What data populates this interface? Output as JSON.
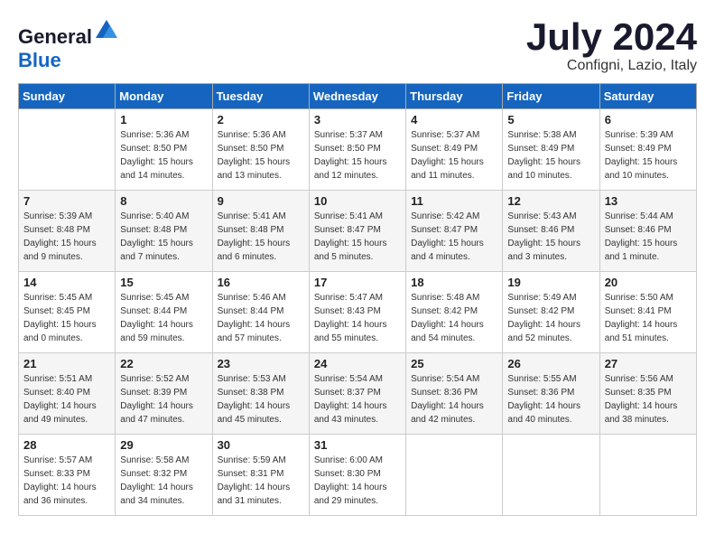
{
  "header": {
    "logo_general": "General",
    "logo_blue": "Blue",
    "month_year": "July 2024",
    "location": "Configni, Lazio, Italy"
  },
  "days_of_week": [
    "Sunday",
    "Monday",
    "Tuesday",
    "Wednesday",
    "Thursday",
    "Friday",
    "Saturday"
  ],
  "weeks": [
    [
      {
        "day": "",
        "info": ""
      },
      {
        "day": "1",
        "info": "Sunrise: 5:36 AM\nSunset: 8:50 PM\nDaylight: 15 hours\nand 14 minutes."
      },
      {
        "day": "2",
        "info": "Sunrise: 5:36 AM\nSunset: 8:50 PM\nDaylight: 15 hours\nand 13 minutes."
      },
      {
        "day": "3",
        "info": "Sunrise: 5:37 AM\nSunset: 8:50 PM\nDaylight: 15 hours\nand 12 minutes."
      },
      {
        "day": "4",
        "info": "Sunrise: 5:37 AM\nSunset: 8:49 PM\nDaylight: 15 hours\nand 11 minutes."
      },
      {
        "day": "5",
        "info": "Sunrise: 5:38 AM\nSunset: 8:49 PM\nDaylight: 15 hours\nand 10 minutes."
      },
      {
        "day": "6",
        "info": "Sunrise: 5:39 AM\nSunset: 8:49 PM\nDaylight: 15 hours\nand 10 minutes."
      }
    ],
    [
      {
        "day": "7",
        "info": "Sunrise: 5:39 AM\nSunset: 8:48 PM\nDaylight: 15 hours\nand 9 minutes."
      },
      {
        "day": "8",
        "info": "Sunrise: 5:40 AM\nSunset: 8:48 PM\nDaylight: 15 hours\nand 7 minutes."
      },
      {
        "day": "9",
        "info": "Sunrise: 5:41 AM\nSunset: 8:48 PM\nDaylight: 15 hours\nand 6 minutes."
      },
      {
        "day": "10",
        "info": "Sunrise: 5:41 AM\nSunset: 8:47 PM\nDaylight: 15 hours\nand 5 minutes."
      },
      {
        "day": "11",
        "info": "Sunrise: 5:42 AM\nSunset: 8:47 PM\nDaylight: 15 hours\nand 4 minutes."
      },
      {
        "day": "12",
        "info": "Sunrise: 5:43 AM\nSunset: 8:46 PM\nDaylight: 15 hours\nand 3 minutes."
      },
      {
        "day": "13",
        "info": "Sunrise: 5:44 AM\nSunset: 8:46 PM\nDaylight: 15 hours\nand 1 minute."
      }
    ],
    [
      {
        "day": "14",
        "info": "Sunrise: 5:45 AM\nSunset: 8:45 PM\nDaylight: 15 hours\nand 0 minutes."
      },
      {
        "day": "15",
        "info": "Sunrise: 5:45 AM\nSunset: 8:44 PM\nDaylight: 14 hours\nand 59 minutes."
      },
      {
        "day": "16",
        "info": "Sunrise: 5:46 AM\nSunset: 8:44 PM\nDaylight: 14 hours\nand 57 minutes."
      },
      {
        "day": "17",
        "info": "Sunrise: 5:47 AM\nSunset: 8:43 PM\nDaylight: 14 hours\nand 55 minutes."
      },
      {
        "day": "18",
        "info": "Sunrise: 5:48 AM\nSunset: 8:42 PM\nDaylight: 14 hours\nand 54 minutes."
      },
      {
        "day": "19",
        "info": "Sunrise: 5:49 AM\nSunset: 8:42 PM\nDaylight: 14 hours\nand 52 minutes."
      },
      {
        "day": "20",
        "info": "Sunrise: 5:50 AM\nSunset: 8:41 PM\nDaylight: 14 hours\nand 51 minutes."
      }
    ],
    [
      {
        "day": "21",
        "info": "Sunrise: 5:51 AM\nSunset: 8:40 PM\nDaylight: 14 hours\nand 49 minutes."
      },
      {
        "day": "22",
        "info": "Sunrise: 5:52 AM\nSunset: 8:39 PM\nDaylight: 14 hours\nand 47 minutes."
      },
      {
        "day": "23",
        "info": "Sunrise: 5:53 AM\nSunset: 8:38 PM\nDaylight: 14 hours\nand 45 minutes."
      },
      {
        "day": "24",
        "info": "Sunrise: 5:54 AM\nSunset: 8:37 PM\nDaylight: 14 hours\nand 43 minutes."
      },
      {
        "day": "25",
        "info": "Sunrise: 5:54 AM\nSunset: 8:36 PM\nDaylight: 14 hours\nand 42 minutes."
      },
      {
        "day": "26",
        "info": "Sunrise: 5:55 AM\nSunset: 8:36 PM\nDaylight: 14 hours\nand 40 minutes."
      },
      {
        "day": "27",
        "info": "Sunrise: 5:56 AM\nSunset: 8:35 PM\nDaylight: 14 hours\nand 38 minutes."
      }
    ],
    [
      {
        "day": "28",
        "info": "Sunrise: 5:57 AM\nSunset: 8:33 PM\nDaylight: 14 hours\nand 36 minutes."
      },
      {
        "day": "29",
        "info": "Sunrise: 5:58 AM\nSunset: 8:32 PM\nDaylight: 14 hours\nand 34 minutes."
      },
      {
        "day": "30",
        "info": "Sunrise: 5:59 AM\nSunset: 8:31 PM\nDaylight: 14 hours\nand 31 minutes."
      },
      {
        "day": "31",
        "info": "Sunrise: 6:00 AM\nSunset: 8:30 PM\nDaylight: 14 hours\nand 29 minutes."
      },
      {
        "day": "",
        "info": ""
      },
      {
        "day": "",
        "info": ""
      },
      {
        "day": "",
        "info": ""
      }
    ]
  ]
}
